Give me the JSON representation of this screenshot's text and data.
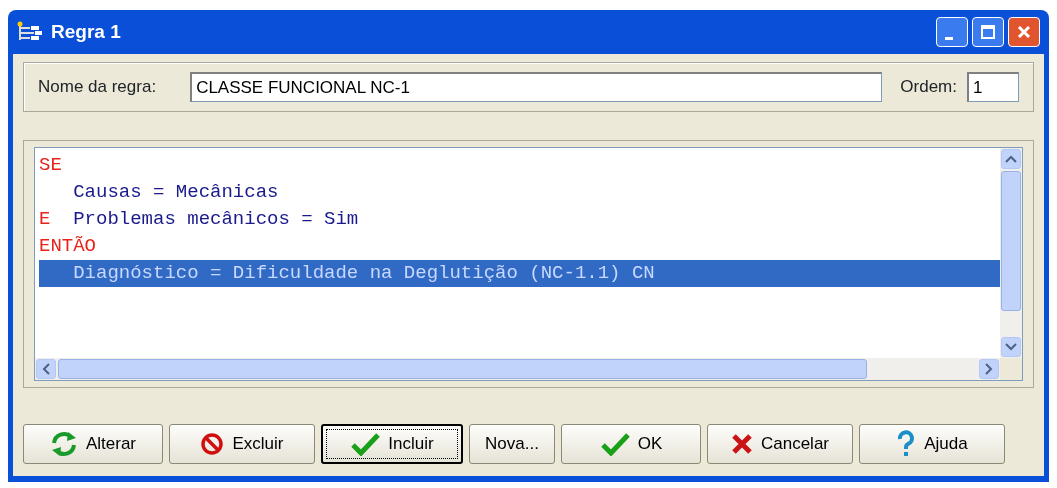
{
  "window": {
    "title": "Regra 1"
  },
  "rule_name": {
    "label": "Nome da regra:",
    "value": "CLASSE FUNCIONAL NC-1"
  },
  "order": {
    "label": "Ordem:",
    "value": "1"
  },
  "rule_lines": [
    {
      "kind": "keyword",
      "text": "SE",
      "selected": false
    },
    {
      "kind": "clause",
      "text": "Causas = Mecânicas",
      "selected": false
    },
    {
      "kind": "conjunction",
      "keyword": "E",
      "text": "Problemas mecânicos = Sim",
      "selected": false
    },
    {
      "kind": "keyword",
      "text": "ENTÃO",
      "selected": false
    },
    {
      "kind": "clause",
      "text": "Diagnóstico = Dificuldade na Deglutição (NC-1.1) CN",
      "selected": true
    }
  ],
  "buttons": [
    {
      "label": "Alterar",
      "kind": "refresh",
      "focused": false
    },
    {
      "label": "Excluir",
      "kind": "forbidden",
      "focused": false
    },
    {
      "label": "Incluir",
      "kind": "check",
      "focused": true
    },
    {
      "label": "Nova...",
      "kind": "plain",
      "focused": false
    },
    {
      "label": "OK",
      "kind": "check",
      "focused": false
    },
    {
      "label": "Cancelar",
      "kind": "cross",
      "focused": false
    },
    {
      "label": "Ajuda",
      "kind": "help",
      "focused": false
    }
  ]
}
